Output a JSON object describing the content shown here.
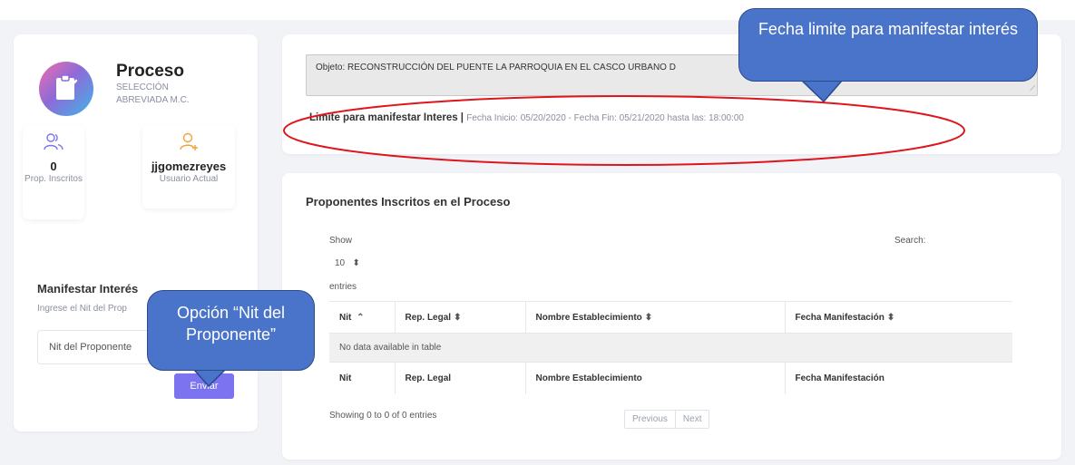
{
  "process": {
    "title": "Proceso",
    "subtitle": "SELECCIÓN ABREVIADA M.C.",
    "logo_icon": "clipboard-icon"
  },
  "stats": {
    "proponents_count": "0",
    "proponents_label": "Prop. Inscritos",
    "proponents_icon": "users-icon",
    "username": "jjgomezreyes",
    "user_label": "Usuario Actual",
    "user_icon": "user-add-icon"
  },
  "manifest": {
    "title": "Manifestar Interés",
    "subtitle": "Ingrese el Nit del Prop",
    "input_placeholder": "Nit del Proponente",
    "send_label": "Enviar"
  },
  "objeto": {
    "text": "Objeto: RECONSTRUCCIÓN DEL PUENTE LA PARROQUIA EN EL CASCO URBANO D"
  },
  "limit": {
    "label": "Limite para manifestar Interes |",
    "dates": "Fecha Inicio: 05/20/2020 - Fecha Fin: 05/21/2020 hasta las: 18:00:00"
  },
  "table": {
    "title": "Proponentes Inscritos en el Proceso",
    "show_label": "Show",
    "page_size": "10",
    "entries_label": "entries",
    "search_label": "Search:",
    "columns": [
      "Nit",
      "Rep. Legal",
      "Nombre Establecimiento",
      "Fecha Manifestación"
    ],
    "empty_message": "No data available in table",
    "info": "Showing 0 to 0 of 0 entries",
    "prev_label": "Previous",
    "next_label": "Next"
  },
  "annotations": {
    "fecha_callout": "Fecha limite para manifestar interés",
    "nit_callout": "Opción “Nit del Proponente”",
    "callout_color": "#4a74c9",
    "highlight_color": "#e0151b"
  },
  "colors": {
    "accent": "#7b73f0",
    "page_bg": "#f1f3f7",
    "muted_text": "#8a8fa0"
  }
}
